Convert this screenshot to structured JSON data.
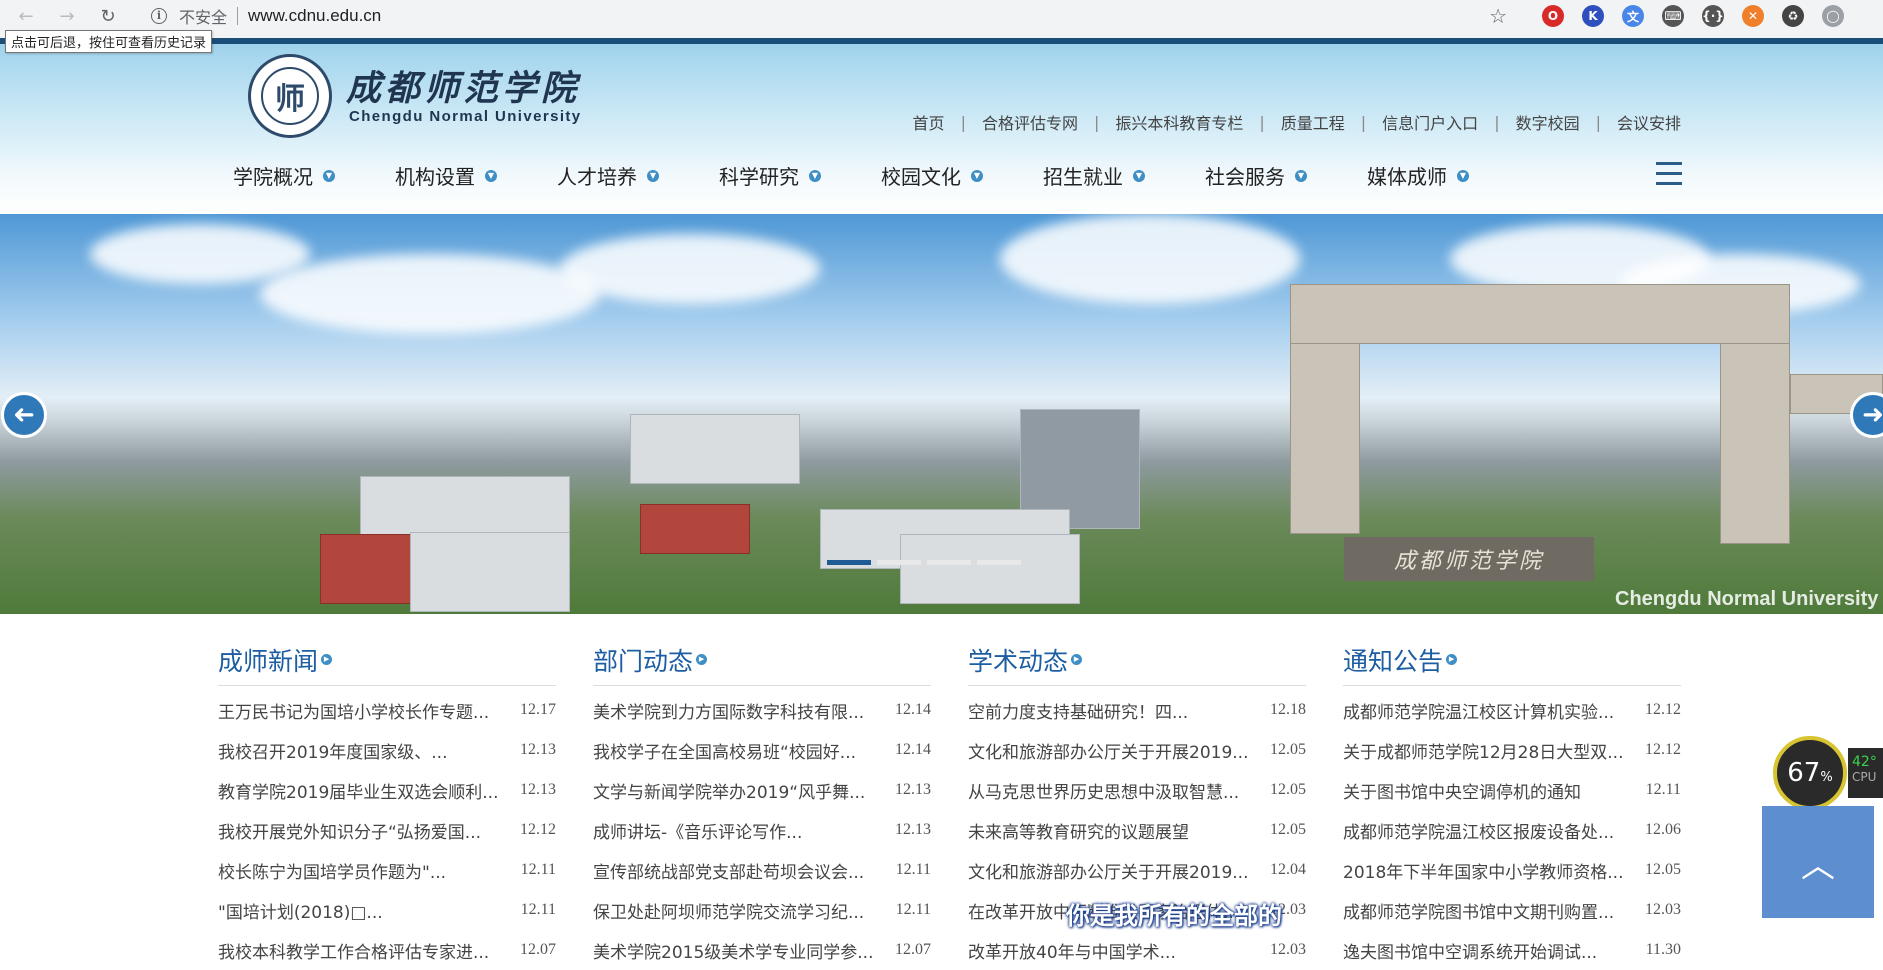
{
  "browser": {
    "back": "←",
    "forward": "→",
    "reload": "↻",
    "security_label": "不安全",
    "url": "www.cdnu.edu.cn",
    "star": "☆",
    "tooltip": "点击可后退，按住可查看历史记录",
    "extensions": [
      {
        "name": "opera-extension-icon",
        "glyph": "O",
        "color": "#d92a2a"
      },
      {
        "name": "k-extension-icon",
        "glyph": "K",
        "color": "#2f4fbf"
      },
      {
        "name": "translate-extension-icon",
        "glyph": "文",
        "color": "#4a86e8"
      },
      {
        "name": "keyboard-extension-icon",
        "glyph": "⌨",
        "color": "#555555"
      },
      {
        "name": "json-extension-icon",
        "glyph": "{·}",
        "color": "#555555"
      },
      {
        "name": "orange-extension-icon",
        "glyph": "✕",
        "color": "#ef7f2a"
      },
      {
        "name": "recycle-extension-icon",
        "glyph": "♻",
        "color": "#444444"
      },
      {
        "name": "profile-avatar-icon",
        "glyph": "◯",
        "color": "#9aa0a6"
      }
    ]
  },
  "site": {
    "logo_emblem": "师",
    "logo_cn": "成都师范学院",
    "logo_en": "Chengdu Normal University",
    "top_links": [
      "首页",
      "合格评估专网",
      "振兴本科教育专栏",
      "质量工程",
      "信息门户入口",
      "数字校园",
      "会议安排"
    ],
    "nav": [
      "学院概况",
      "机构设置",
      "人才培养",
      "科学研究",
      "校园文化",
      "招生就业",
      "社会服务",
      "媒体成师"
    ],
    "banner_plaque": "成都师范学院",
    "banner_caption": "Chengdu Normal University",
    "banner_prev": "➜",
    "banner_next": "➜",
    "slide_count": 4,
    "active_slide": 1
  },
  "news": [
    {
      "title": "成师新闻",
      "items": [
        {
          "title": "王万民书记为国培小学校长作专题...",
          "date": "12.17"
        },
        {
          "title": "我校召开2019年度国家级、...",
          "date": "12.13"
        },
        {
          "title": "教育学院2019届毕业生双选会顺利...",
          "date": "12.13"
        },
        {
          "title": "我校开展党外知识分子“弘扬爱国...",
          "date": "12.12"
        },
        {
          "title": "校长陈宁为国培学员作题为\"...",
          "date": "12.11"
        },
        {
          "title": "\"国培计划(2018)□...",
          "date": "12.11"
        },
        {
          "title": "我校本科教学工作合格评估专家进...",
          "date": "12.07"
        }
      ]
    },
    {
      "title": "部门动态",
      "items": [
        {
          "title": "美术学院到力方国际数字科技有限...",
          "date": "12.14"
        },
        {
          "title": "我校学子在全国高校易班“校园好...",
          "date": "12.14"
        },
        {
          "title": "文学与新闻学院举办2019“风乎舞...",
          "date": "12.13"
        },
        {
          "title": "成师讲坛-《音乐评论写作...",
          "date": "12.13"
        },
        {
          "title": "宣传部统战部党支部赴苟坝会议会...",
          "date": "12.11"
        },
        {
          "title": "保卫处赴阿坝师范学院交流学习纪...",
          "date": "12.11"
        },
        {
          "title": "美术学院2015级美术学专业同学参...",
          "date": "12.07"
        }
      ]
    },
    {
      "title": "学术动态",
      "items": [
        {
          "title": "空前力度支持基础研究！四...",
          "date": "12.18"
        },
        {
          "title": "文化和旅游部办公厅关于开展2019...",
          "date": "12.05"
        },
        {
          "title": "从马克思世界历史思想中汲取智慧...",
          "date": "12.05"
        },
        {
          "title": "未来高等教育研究的议题展望",
          "date": "12.05"
        },
        {
          "title": "文化和旅游部办公厅关于开展2019...",
          "date": "12.04"
        },
        {
          "title": "在改革开放中不断推进国家治理体...",
          "date": "12.03"
        },
        {
          "title": "改革开放40年与中国学术...",
          "date": "12.03"
        }
      ]
    },
    {
      "title": "通知公告",
      "items": [
        {
          "title": "成都师范学院温江校区计算机实验...",
          "date": "12.12"
        },
        {
          "title": "关于成都师范学院12月28日大型双...",
          "date": "12.12"
        },
        {
          "title": "关于图书馆中央空调停机的通知",
          "date": "12.11"
        },
        {
          "title": "成都师范学院温江校区报废设备处...",
          "date": "12.06"
        },
        {
          "title": "2018年下半年国家中小学教师资格...",
          "date": "12.05"
        },
        {
          "title": "成都师范学院图书馆中文期刊购置...",
          "date": "12.03"
        },
        {
          "title": "逸夫图书馆中空调系统开始调试...",
          "date": "11.30"
        }
      ]
    }
  ],
  "widgets": {
    "cpu_percent": "67",
    "cpu_percent_unit": "%",
    "cpu_temp": "42°",
    "cpu_label": "CPU",
    "back_to_top": "︿",
    "subtitle": "你是我所有的全部的"
  }
}
